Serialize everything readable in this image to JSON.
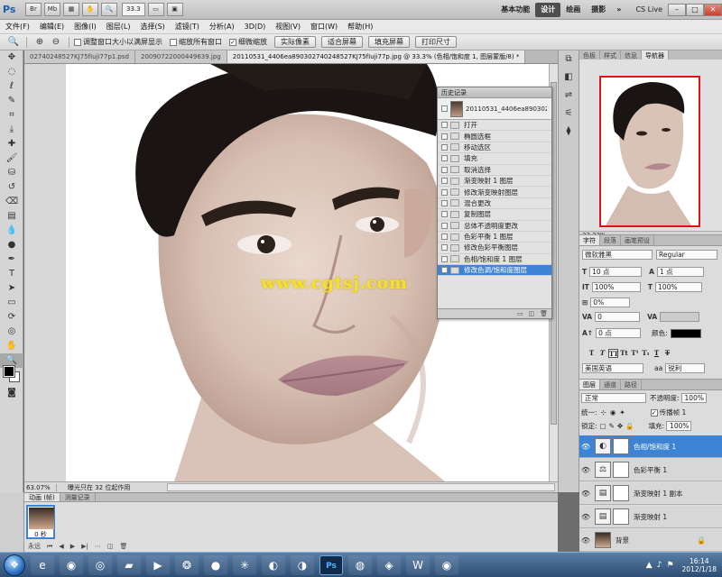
{
  "titlebar": {
    "app": "Ps",
    "zoom": "33.3",
    "workspaces": [
      "基本功能",
      "设计",
      "绘画",
      "摄影"
    ],
    "active_workspace": 1,
    "cslive": "CS Live"
  },
  "menu": [
    "文件(F)",
    "编辑(E)",
    "图像(I)",
    "图层(L)",
    "选择(S)",
    "滤镜(T)",
    "分析(A)",
    "3D(D)",
    "视图(V)",
    "窗口(W)",
    "帮助(H)"
  ],
  "options": {
    "check1": "调整窗口大小以满屏显示",
    "check2": "缩放所有窗口",
    "check3": "细微缩放",
    "btn1": "实际像素",
    "btn2": "适合屏幕",
    "btn3": "填充屏幕",
    "btn4": "打印尺寸"
  },
  "doctabs": [
    "02740248527KJ75fIuji77p1.psd",
    "20090722000449639.jpg",
    "20110531_4406ea890302740248527KJ75fIuji77p.jpg @ 33.3% (色相/饱和度 1, 图层蒙版/8) *"
  ],
  "canvas": {
    "watermark": "www.cgtsj.com",
    "colors": {
      "skin": "#d9c2b6",
      "hair": "#1a1512",
      "bg": "#ffffff"
    }
  },
  "status": {
    "zoom": "63.07%",
    "text": "曝光只在 32 位起作用"
  },
  "history": {
    "title": "历史记录",
    "snapshot": "20110531_4406ea890302...",
    "items": [
      "打开",
      "椭圆选框",
      "移动选区",
      "填充",
      "取消选择",
      "渐变映射 1 图层",
      "修改渐变映射图层",
      "混合更改",
      "复制图层",
      "总体不透明度更改",
      "色彩平衡 1 图层",
      "修改色彩平衡图层",
      "色相/饱和度 1 图层",
      "修改色调/饱和度图层"
    ],
    "active_index": 13
  },
  "navigator": {
    "tabs": [
      "色板",
      "样式",
      "信息",
      "导航器"
    ],
    "active_tab": 3,
    "zoom": "33.33%"
  },
  "character": {
    "tabs": [
      "字符",
      "段落",
      "画笔预设"
    ],
    "font": "微软雅黑",
    "style": "Regular",
    "size": "10 点",
    "leading": "1 点",
    "vscale": "100%",
    "hscale": "100%",
    "tracking_ratio": "0%",
    "kerning": "0",
    "baseline": "0 点",
    "color_label": "颜色:",
    "language": "美国英语",
    "aa_prefix": "aa",
    "aa": "锐利"
  },
  "layers": {
    "tabs": [
      "图层",
      "通道",
      "路径"
    ],
    "blend": "正常",
    "opacity_label": "不透明度:",
    "opacity": "100%",
    "unify_label": "统一:",
    "propagate": "传播帧 1",
    "lock_label": "锁定:",
    "fill_label": "填充:",
    "fill": "100%",
    "rows": [
      {
        "name": "色相/饱和度 1",
        "active": true
      },
      {
        "name": "色彩平衡 1",
        "active": false
      },
      {
        "name": "渐变映射 1 副本",
        "active": false
      },
      {
        "name": "渐变映射 1",
        "active": false
      },
      {
        "name": "背景",
        "active": false
      }
    ]
  },
  "animation": {
    "tabs": [
      "动画 (帧)",
      "测量记录"
    ],
    "frame_time": "0 秒",
    "loop": "永远"
  },
  "taskbar": {
    "time": "16:14",
    "date": "2012/1/18",
    "ps_label": "Ps"
  }
}
